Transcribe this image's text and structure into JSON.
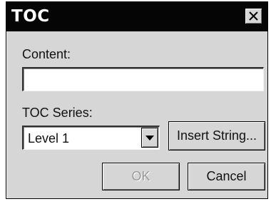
{
  "window": {
    "title": "TOC",
    "close_icon": "close-icon"
  },
  "content": {
    "label": "Content:",
    "value": "",
    "placeholder": ""
  },
  "toc_series": {
    "label": "TOC Series:",
    "selected": "Level 1",
    "arrow_icon": "chevron-down-icon"
  },
  "buttons": {
    "insert_string": "Insert String...",
    "ok": "OK",
    "ok_enabled": false,
    "cancel": "Cancel"
  },
  "colors": {
    "titlebar": "#050505",
    "title_text": "#ffffff",
    "dialog_face": "#d6d6d6",
    "disabled_text": "#9a9a9a"
  }
}
